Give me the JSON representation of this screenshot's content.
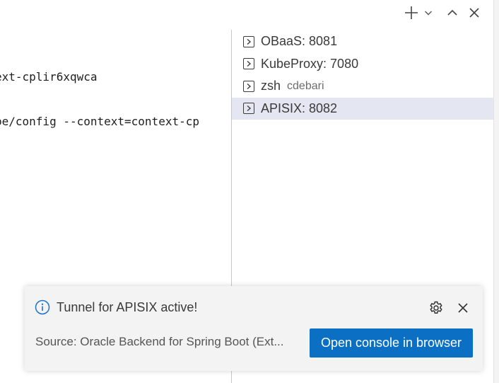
{
  "topbar": {
    "icons": [
      "plus-icon",
      "chevron-down-icon",
      "chevron-up-icon",
      "close-icon"
    ]
  },
  "terminal": {
    "lines": [
      "ext-cplir6xqwca",
      "be/config --context=context-cp"
    ]
  },
  "terminal_list": {
    "items": [
      {
        "label": "OBaaS: 8081",
        "sub": "",
        "active": false,
        "icon": "terminal-icon"
      },
      {
        "label": "KubeProxy: 7080",
        "sub": "",
        "active": false,
        "icon": "terminal-icon"
      },
      {
        "label": "zsh",
        "sub": "cdebari",
        "active": false,
        "icon": "terminal-icon"
      },
      {
        "label": "APISIX: 8082",
        "sub": "",
        "active": true,
        "icon": "terminal-icon"
      }
    ]
  },
  "notification": {
    "icon": "info-icon",
    "message": "Tunnel for APISIX active!",
    "source": "Source: Oracle Backend for Spring Boot (Ext...",
    "action_label": "Open console in browser",
    "accent_color": "#0b6fc4"
  }
}
